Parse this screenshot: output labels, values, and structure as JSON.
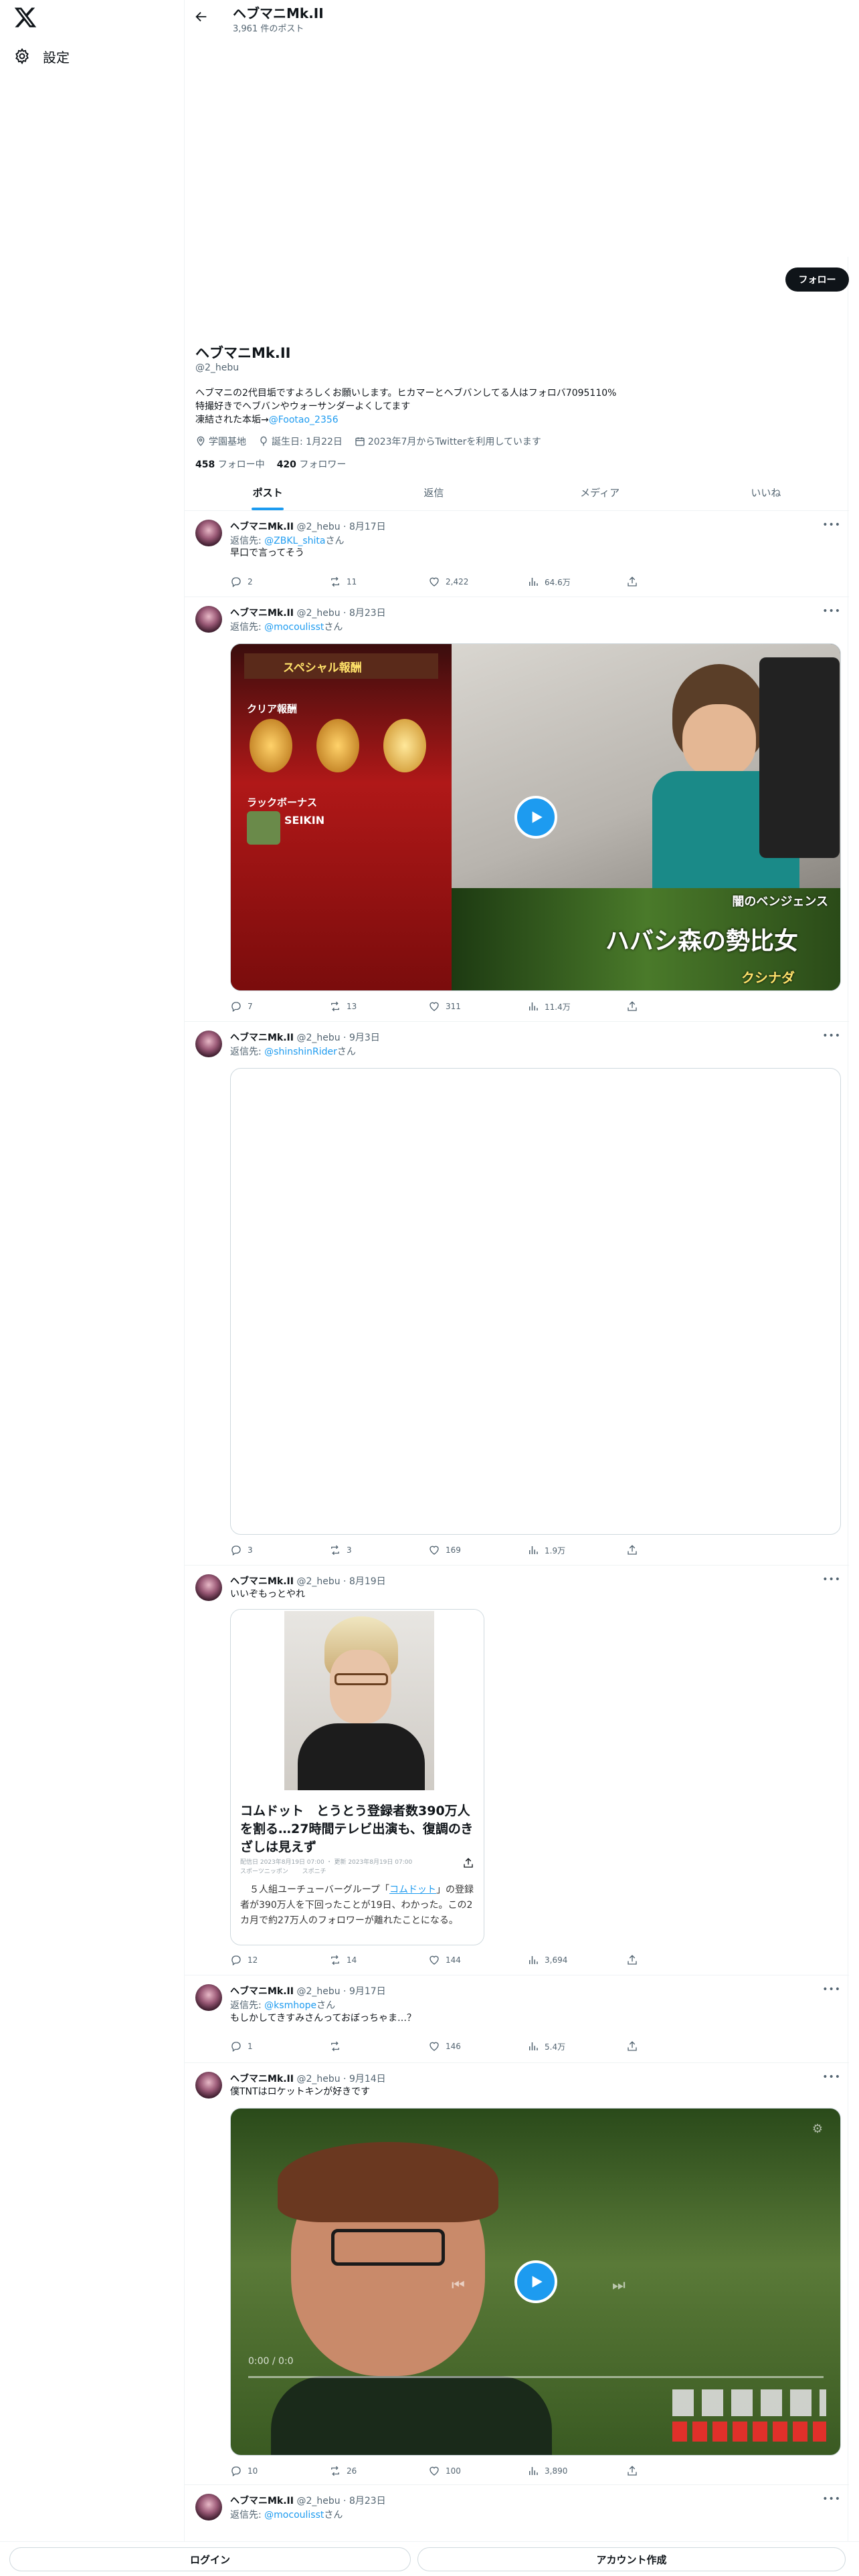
{
  "topbar": {
    "title": "ヘブマニMk.II",
    "post_count": "3,961 件のポスト"
  },
  "sidebar": {
    "settings_label": "設定"
  },
  "profile": {
    "follow_label": "フォロー",
    "name": "ヘブマニMk.II",
    "handle": "@2_hebu",
    "bio_line1": "ヘブマニの2代目垢ですよろしくお願いします。ヒカマーとヘブバンしてる人はフォロバ7095110%",
    "bio_line2": "特撮好きでヘブバンやウォーサンダーよくしてます",
    "bio_line3_prefix": "凍結された本垢→",
    "bio_line3_link": "@Footao_2356",
    "location": "学園基地",
    "birthday": "誕生日: 1月22日",
    "joined": "2023年7月からTwitterを利用しています",
    "following_count": "458",
    "following_label": "フォロー中",
    "followers_count": "420",
    "followers_label": "フォロワー"
  },
  "tabs": [
    "ポスト",
    "返信",
    "メディア",
    "いいね"
  ],
  "posts": [
    {
      "name": "ヘブマニMk.II",
      "handle": "@2_hebu",
      "date": "8月17日",
      "reply_prefix": "返信先: ",
      "reply_to": "@ZBKL_shita",
      "reply_suffix": "さん",
      "text": "早口で言ってそう",
      "replies": "2",
      "reposts": "11",
      "likes": "2,422",
      "views": "64.6万"
    },
    {
      "name": "ヘブマニMk.II",
      "handle": "@2_hebu",
      "date": "8月23日",
      "reply_prefix": "返信先: ",
      "reply_to": "@mocoulisst",
      "reply_suffix": "さん",
      "media_text1": "スペシャル報酬",
      "media_text2": "クリア報酬",
      "media_text3": "ラックボーナス",
      "media_text4": "SEIKIN",
      "media_text5": "闇のベンジェンス",
      "media_text6": "ハバシ森の勢比女",
      "media_text7": "クシナダ",
      "replies": "7",
      "reposts": "13",
      "likes": "311",
      "views": "11.4万"
    },
    {
      "name": "ヘブマニMk.II",
      "handle": "@2_hebu",
      "date": "9月3日",
      "reply_prefix": "返信先: ",
      "reply_to": "@shinshinRider",
      "reply_suffix": "さん",
      "replies": "3",
      "reposts": "3",
      "likes": "169",
      "views": "1.9万"
    },
    {
      "name": "ヘブマニMk.II",
      "handle": "@2_hebu",
      "date": "8月19日",
      "text": "いいぞもっとやれ",
      "card_title": "コムドット　とうとう登録者数390万人を割る…27時間テレビ出演も、復調のきざしは見えず",
      "card_meta1": "配信日 2023年8月19日 07:00 ・ 更新 2023年8月19日 07:00",
      "card_meta2": "スポーツニッポン　　 スポニチ",
      "card_body_prefix": "　５人組ユーチューバーグループ「",
      "card_body_link": "コムドット",
      "card_body_suffix": "」の登録者が390万人を下回ったことが19日、わかった。この2カ月で約27万人のフォロワーが離れたことになる。",
      "replies": "12",
      "reposts": "14",
      "likes": "144",
      "views": "3,694"
    },
    {
      "name": "ヘブマニMk.II",
      "handle": "@2_hebu",
      "date": "9月17日",
      "reply_prefix": "返信先: ",
      "reply_to": "@ksmhope",
      "reply_suffix": "さん",
      "text": "もしかしてきすみさんっておぼっちゃま…？",
      "replies": "1",
      "reposts": "",
      "likes": "146",
      "views": "5.4万"
    },
    {
      "name": "ヘブマニMk.II",
      "handle": "@2_hebu",
      "date": "9月14日",
      "text": "僕TNTはロケットキンが好きです",
      "video_time": "0:00 / 0:0",
      "replies": "10",
      "reposts": "26",
      "likes": "100",
      "views": "3,890"
    },
    {
      "name": "ヘブマニMk.II",
      "handle": "@2_hebu",
      "date": "8月23日",
      "reply_prefix": "返信先: ",
      "reply_to": "@mocoulisst",
      "reply_suffix": "さん"
    }
  ],
  "bottom": {
    "login_label": "ログイン",
    "signup_label": "アカウント作成"
  }
}
